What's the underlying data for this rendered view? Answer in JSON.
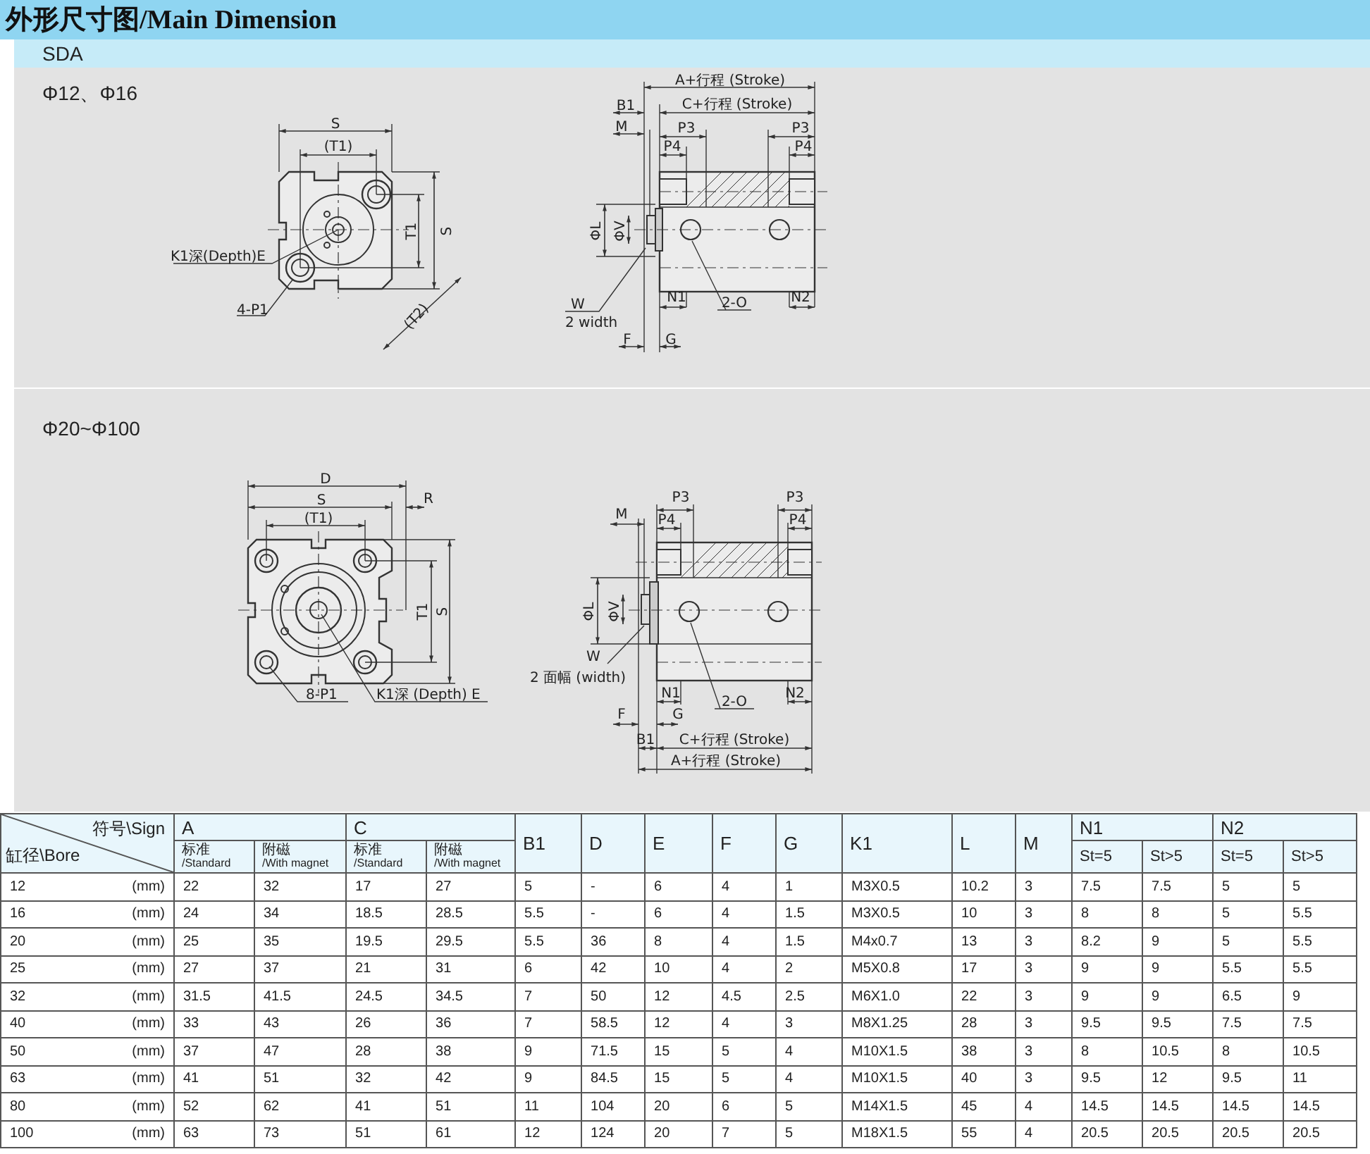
{
  "header": {
    "title": "外形尺寸图/Main Dimension",
    "model": "SDA"
  },
  "sections": [
    {
      "kind": "small",
      "title": "Φ12、Φ16",
      "front_labels": [
        "S",
        "(T1)",
        "T1",
        "S",
        "(T2)",
        "K1深(Depth)E",
        "4-P1"
      ],
      "side_labels": [
        "A+行程 (Stroke)",
        "B1",
        "C+行程 (Stroke)",
        "M",
        "P3",
        "P3",
        "P4",
        "P4",
        "ΦL",
        "ΦV",
        "N1",
        "2-O",
        "N2",
        "W",
        "2 width",
        "F",
        "G"
      ]
    },
    {
      "kind": "large",
      "title": "Φ20~Φ100",
      "front_labels": [
        "D",
        "S",
        "R",
        "(T1)",
        "T1",
        "S",
        "8-P1",
        "K1深 (Depth) E"
      ],
      "side_labels": [
        "P3",
        "P3",
        "M",
        "P4",
        "P4",
        "ΦL",
        "ΦV",
        "W",
        "2 面幅 (width)",
        "N1",
        "2-O",
        "N2",
        "G",
        "F",
        "B1",
        "C+行程 (Stroke)",
        "A+行程 (Stroke)"
      ]
    }
  ],
  "table": {
    "corner": {
      "sign": "符号\\Sign",
      "bore": "缸径\\Bore"
    },
    "groups": [
      {
        "label": "A",
        "sub": [
          {
            "zh": "标准",
            "en": "/Standard"
          },
          {
            "zh": "附磁",
            "en": "/With magnet"
          }
        ]
      },
      {
        "label": "C",
        "sub": [
          {
            "zh": "标准",
            "en": "/Standard"
          },
          {
            "zh": "附磁",
            "en": "/With magnet"
          }
        ]
      },
      {
        "label": "B1"
      },
      {
        "label": "D"
      },
      {
        "label": "E"
      },
      {
        "label": "F"
      },
      {
        "label": "G"
      },
      {
        "label": "K1"
      },
      {
        "label": "L"
      },
      {
        "label": "M"
      },
      {
        "label": "N1",
        "sub": [
          {
            "en": "St=5"
          },
          {
            "en": "St>5"
          }
        ]
      },
      {
        "label": "N2",
        "sub": [
          {
            "en": "St=5"
          },
          {
            "en": "St>5"
          }
        ]
      }
    ],
    "rows": [
      {
        "bore": "12",
        "unit": "(mm)",
        "values": [
          "22",
          "32",
          "17",
          "27",
          "5",
          "-",
          "6",
          "4",
          "1",
          "M3X0.5",
          "10.2",
          "3",
          "7.5",
          "7.5",
          "5",
          "5"
        ]
      },
      {
        "bore": "16",
        "unit": "(mm)",
        "values": [
          "24",
          "34",
          "18.5",
          "28.5",
          "5.5",
          "-",
          "6",
          "4",
          "1.5",
          "M3X0.5",
          "10",
          "3",
          "8",
          "8",
          "5",
          "5.5"
        ]
      },
      {
        "bore": "20",
        "unit": "(mm)",
        "values": [
          "25",
          "35",
          "19.5",
          "29.5",
          "5.5",
          "36",
          "8",
          "4",
          "1.5",
          "M4x0.7",
          "13",
          "3",
          "8.2",
          "9",
          "5",
          "5.5"
        ]
      },
      {
        "bore": "25",
        "unit": "(mm)",
        "values": [
          "27",
          "37",
          "21",
          "31",
          "6",
          "42",
          "10",
          "4",
          "2",
          "M5X0.8",
          "17",
          "3",
          "9",
          "9",
          "5.5",
          "5.5"
        ]
      },
      {
        "bore": "32",
        "unit": "(mm)",
        "values": [
          "31.5",
          "41.5",
          "24.5",
          "34.5",
          "7",
          "50",
          "12",
          "4.5",
          "2.5",
          "M6X1.0",
          "22",
          "3",
          "9",
          "9",
          "6.5",
          "9"
        ]
      },
      {
        "bore": "40",
        "unit": "(mm)",
        "values": [
          "33",
          "43",
          "26",
          "36",
          "7",
          "58.5",
          "12",
          "4",
          "3",
          "M8X1.25",
          "28",
          "3",
          "9.5",
          "9.5",
          "7.5",
          "7.5"
        ]
      },
      {
        "bore": "50",
        "unit": "(mm)",
        "values": [
          "37",
          "47",
          "28",
          "38",
          "9",
          "71.5",
          "15",
          "5",
          "4",
          "M10X1.5",
          "38",
          "3",
          "8",
          "10.5",
          "8",
          "10.5"
        ]
      },
      {
        "bore": "63",
        "unit": "(mm)",
        "values": [
          "41",
          "51",
          "32",
          "42",
          "9",
          "84.5",
          "15",
          "5",
          "4",
          "M10X1.5",
          "40",
          "3",
          "9.5",
          "12",
          "9.5",
          "11"
        ]
      },
      {
        "bore": "80",
        "unit": "(mm)",
        "values": [
          "52",
          "62",
          "41",
          "51",
          "11",
          "104",
          "20",
          "6",
          "5",
          "M14X1.5",
          "45",
          "4",
          "14.5",
          "14.5",
          "14.5",
          "14.5"
        ]
      },
      {
        "bore": "100",
        "unit": "(mm)",
        "values": [
          "63",
          "73",
          "51",
          "61",
          "12",
          "124",
          "20",
          "7",
          "5",
          "M18X1.5",
          "55",
          "4",
          "20.5",
          "20.5",
          "20.5",
          "20.5"
        ]
      }
    ]
  }
}
